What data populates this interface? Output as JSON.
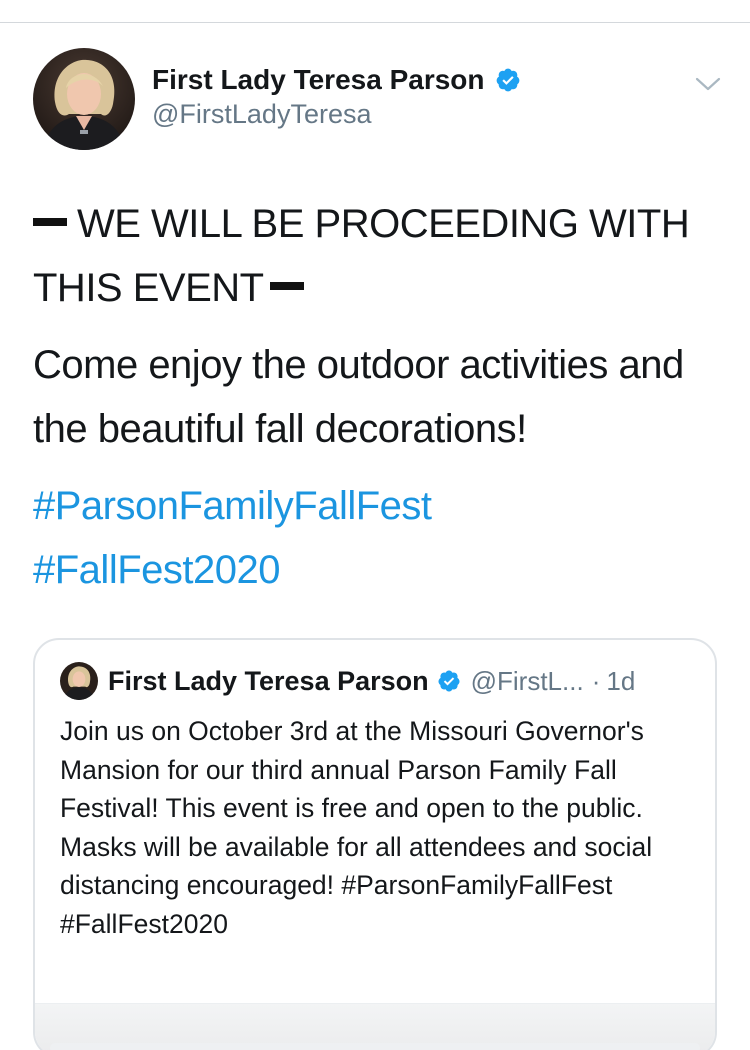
{
  "tweet": {
    "author": {
      "display_name": "First Lady Teresa Parson",
      "handle": "@FirstLadyTeresa"
    },
    "text_line1": "WE WILL BE PROCEEDING WITH THIS EVENT",
    "text_line2": "Come enjoy the outdoor activities and the beautiful fall decorations!",
    "hashtags": [
      "#ParsonFamilyFallFest",
      "#FallFest2020"
    ]
  },
  "quoted_tweet": {
    "display_name": "First Lady Teresa Parson",
    "handle": "@FirstL...",
    "separator": "·",
    "time": "1d",
    "text": "Join us on October 3rd at the Missouri Governor's Mansion for our third annual Parson Family Fall Festival! This event is free and open to the public. Masks will be available for all attendees and social distancing encouraged! #ParsonFamilyFallFest #FallFest2020"
  },
  "colors": {
    "link": "#1b95e0",
    "verified": "#1da1f2",
    "secondary_text": "#657786"
  },
  "icons": {
    "verified": "verified-badge-icon",
    "menu": "chevron-down-icon"
  }
}
